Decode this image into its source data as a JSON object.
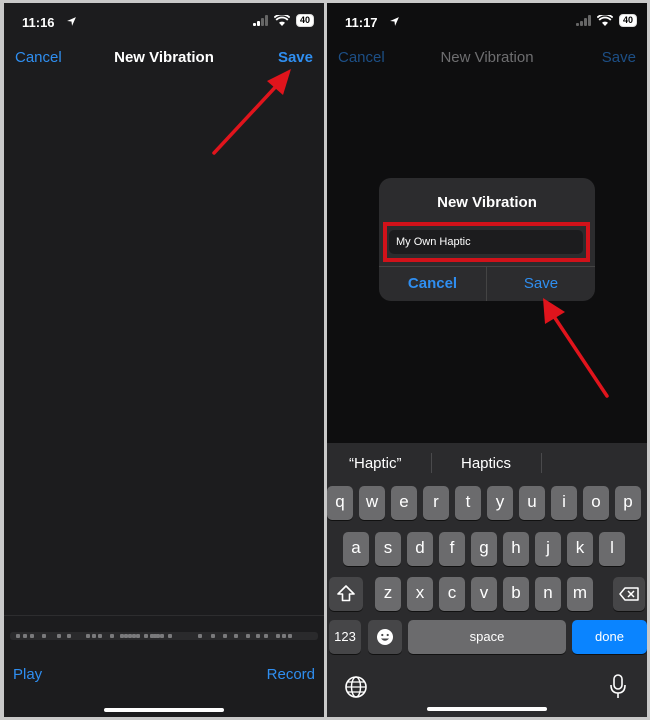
{
  "left": {
    "status": {
      "time": "11:16",
      "battery": "40"
    },
    "nav": {
      "cancel": "Cancel",
      "title": "New Vibration",
      "save": "Save"
    },
    "bottom": {
      "play": "Play",
      "record": "Record"
    }
  },
  "right": {
    "status": {
      "time": "11:17",
      "battery": "40"
    },
    "nav": {
      "cancel": "Cancel",
      "title": "New Vibration",
      "save": "Save"
    },
    "dialog": {
      "title": "New Vibration",
      "input_value": "My Own Haptic",
      "cancel": "Cancel",
      "save": "Save"
    },
    "keyboard": {
      "suggestions": [
        "“Haptic”",
        "Haptics"
      ],
      "row1": [
        "q",
        "w",
        "e",
        "r",
        "t",
        "y",
        "u",
        "i",
        "o",
        "p"
      ],
      "row2": [
        "a",
        "s",
        "d",
        "f",
        "g",
        "h",
        "j",
        "k",
        "l"
      ],
      "row3": [
        "z",
        "x",
        "c",
        "v",
        "b",
        "n",
        "m"
      ],
      "numbers": "123",
      "space": "space",
      "done": "done"
    }
  },
  "colors": {
    "accent": "#2f8ef0",
    "highlight": "#d1121a",
    "done_key": "#0a84ff"
  }
}
